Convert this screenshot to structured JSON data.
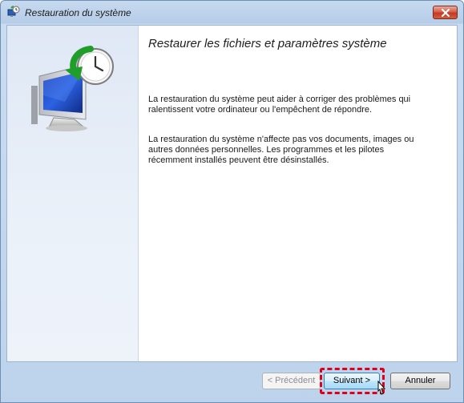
{
  "window": {
    "title": "Restauration du système"
  },
  "content": {
    "heading": "Restaurer les fichiers et paramètres système",
    "paragraph1": "La restauration du système peut aider à corriger des problèmes qui ralentissent votre ordinateur ou l'empêchent de répondre.",
    "paragraph2": "La restauration du système n'affecte pas vos documents, images ou autres données personnelles. Les programmes et les pilotes récemment installés peuvent être désinstallés."
  },
  "buttons": {
    "previous": "< Précédent",
    "next": "Suivant >",
    "cancel": "Annuler"
  },
  "icons": {
    "title_icon": "system-restore-icon",
    "hero_icon": "monitor-clock-restore-icon",
    "close_icon": "close-icon",
    "cursor": "mouse-pointer-icon"
  },
  "colors": {
    "highlight": "#e0001a",
    "close_button": "#c43a23",
    "primary_button_border": "#3c7fb1"
  }
}
